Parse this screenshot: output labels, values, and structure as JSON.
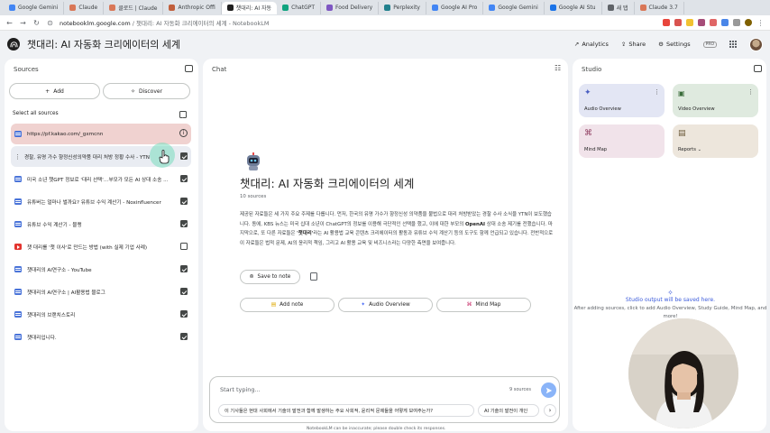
{
  "browser": {
    "tabs": [
      {
        "label": "Google Gemini",
        "color": "#4285f4"
      },
      {
        "label": "Claude",
        "color": "#d97757"
      },
      {
        "label": "클로드 | Claude",
        "color": "#d97757"
      },
      {
        "label": "Anthropic Offi",
        "color": "#c15f3c"
      },
      {
        "label": "챗대리: AI 자동",
        "color": "#1f1f1f"
      },
      {
        "label": "ChatGPT",
        "color": "#10a37f"
      },
      {
        "label": "Food Delivery",
        "color": "#7e57c2"
      },
      {
        "label": "Perplexity",
        "color": "#20808d"
      },
      {
        "label": "Google AI Pro",
        "color": "#4285f4"
      },
      {
        "label": "Google Gemini",
        "color": "#4285f4"
      },
      {
        "label": "Google AI Stu",
        "color": "#1a73e8"
      },
      {
        "label": "새 탭",
        "color": "#5f6368"
      },
      {
        "label": "Claude 3.7",
        "color": "#d97757"
      }
    ],
    "url_host": "notebooklm.google.com",
    "url_title": "챗대리: AI 자동화 크리에이터의 세계 - NotebookLM"
  },
  "header": {
    "title": "챗대리: AI 자동화 크리에이터의 세계",
    "analytics": "Analytics",
    "share": "Share",
    "settings": "Settings",
    "pro": "PRO"
  },
  "sources": {
    "panel_title": "Sources",
    "add_label": "Add",
    "discover_label": "Discover",
    "select_all": "Select all sources",
    "items": [
      "https://pf.kakao.com/_gxmcnn",
      "경찰, 유명 가수 향정신성의약품 대리 처방 정황 수사 - YTN",
      "미국 소년 챗GPT 정보로 '대리 선택'…부모가 모든 AI 상대 소송 ...",
      "유튜버는 얼마나 벌까요? 유튜브 수익 계산기 - Noxinfluencer",
      "유튜브 수익 계산기 - 블랭",
      "챗 대리를 '챗 이사'로 만드는 방법 (with 실제 기업 사례)",
      "챗대리의 AI연구소 - YouTube",
      "챗대리의 AI연구소 | AI활용법 블로그",
      "챗대리의 브랜치스토리",
      "챗대리입니다."
    ]
  },
  "chat": {
    "panel_title": "Chat",
    "title": "챗대리: AI 자동화 크리에이터의 세계",
    "count": "10 sources",
    "summary_1": "제공된 자료들은 세 가지 주요 주제를 다룹니다. 먼저, 한국의 유명 가수가 향정신성 의약품을 불법으로 대리 처방받았는 경찰 수사 소식을 YTN이 보도했습니다. 동에, KBS 뉴스는 미국 십대 소년이 ChatGPT의 정보를 이용해 극단적인 선택을 했고, 이에 대한 부모의 ",
    "summary_bold_1": "OpenAI",
    "summary_2": " 상대 소송 제기를 전했습니다. 마지막으로, 또 다른 자료들은 ",
    "summary_bold_2": "'챗대리'",
    "summary_3": "라는 AI 활용법 교육 콘텐츠 크리에이터의 활동과 유튜브 수익 계산기 등의 도구도 함께 언급되고 있습니다. 전반적으로 이 자료들은 법적 문제, AI의 윤리적 책임, 그리고 AI 활용 교육 및 비즈니스라는 다양한 측면을 보여줍니다.",
    "save_note": "Save to note",
    "add_note": "Add note",
    "audio_overview": "Audio Overview",
    "mind_map": "Mind Map",
    "input_placeholder": "Start typing...",
    "input_sources": "9 sources",
    "suggestion_1": "이 기사들은 현대 사회에서 기술의 발전과 함께 발생하는 주요 사회적, 윤리적 문제들을 어떻게 보여주는가?",
    "suggestion_2": "AI 기술의 발전이 개인",
    "disclaimer": "NotebookLM can be inaccurate; please double check its responses."
  },
  "studio": {
    "panel_title": "Studio",
    "cards": {
      "audio": "Audio Overview",
      "video": "Video Overview",
      "mindmap": "Mind Map",
      "reports": "Reports"
    },
    "empty_title": "Studio output will be saved here.",
    "empty_sub": "After adding sources, click to add Audio Overview, Study Guide, Mind Map, and more!"
  }
}
